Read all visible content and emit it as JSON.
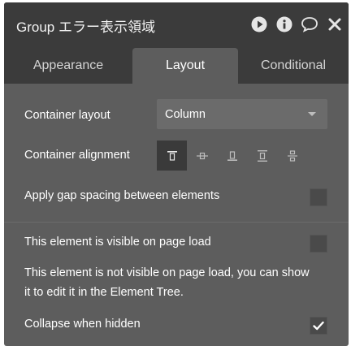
{
  "window": {
    "title": "Group エラー表示領域",
    "icons": [
      "play-icon",
      "info-icon",
      "comment-icon",
      "close-icon"
    ]
  },
  "tabs": [
    {
      "label": "Appearance",
      "active": false
    },
    {
      "label": "Layout",
      "active": true
    },
    {
      "label": "Conditional",
      "active": false
    }
  ],
  "layout": {
    "container_layout_label": "Container layout",
    "container_layout_value": "Column",
    "container_alignment_label": "Container alignment",
    "alignment_options": [
      "align-top-icon",
      "align-center-icon",
      "align-bottom-icon",
      "align-space-between-icon",
      "align-space-around-icon"
    ],
    "alignment_selected": "align-top-icon",
    "gap_label": "Apply gap spacing between elements",
    "gap_checked": false,
    "visible_label": "This element is visible on page load",
    "visible_checked": false,
    "visible_note": "This element is not visible on page load, you can show it to edit it in the Element Tree.",
    "collapse_label": "Collapse when hidden",
    "collapse_checked": true
  },
  "colors": {
    "panel_bg": "#5d5d5d",
    "header_bg": "#3b3b3b",
    "text": "#ffffff"
  }
}
